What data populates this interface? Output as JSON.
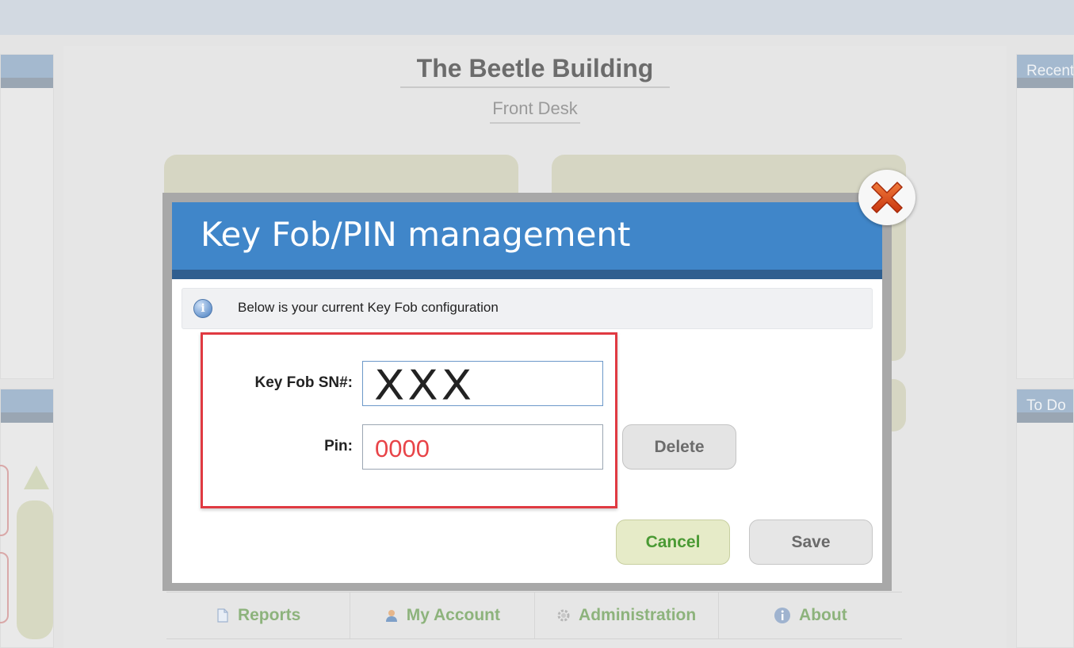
{
  "background": {
    "left_panel_top_title": "",
    "right_panel_recent_title": "Recent",
    "right_panel_todo_title": "To Do",
    "building_title": "The Beetle Building",
    "building_subtitle": "Front Desk"
  },
  "nav": {
    "items": [
      {
        "label": "Reports",
        "icon": "document-icon"
      },
      {
        "label": "My Account",
        "icon": "user-icon"
      },
      {
        "label": "Administration",
        "icon": "gear-icon"
      },
      {
        "label": "About",
        "icon": "info-icon"
      }
    ]
  },
  "modal": {
    "title": "Key Fob/PIN management",
    "info_icon_glyph": "i",
    "info_text": "Below is your current Key Fob configuration",
    "key_fob_label": "Key Fob SN#:",
    "key_fob_value": "XXX",
    "pin_label": "Pin:",
    "pin_value": "0000",
    "delete_label": "Delete",
    "cancel_label": "Cancel",
    "save_label": "Save",
    "close_icon": "close-x-icon"
  },
  "colors": {
    "header_blue": "#4086c9",
    "header_stripe": "#2f5e8f",
    "highlight_red": "#e03a42",
    "pin_red": "#e84448",
    "cancel_green": "#4a9a34",
    "nav_green": "#8db37c"
  }
}
